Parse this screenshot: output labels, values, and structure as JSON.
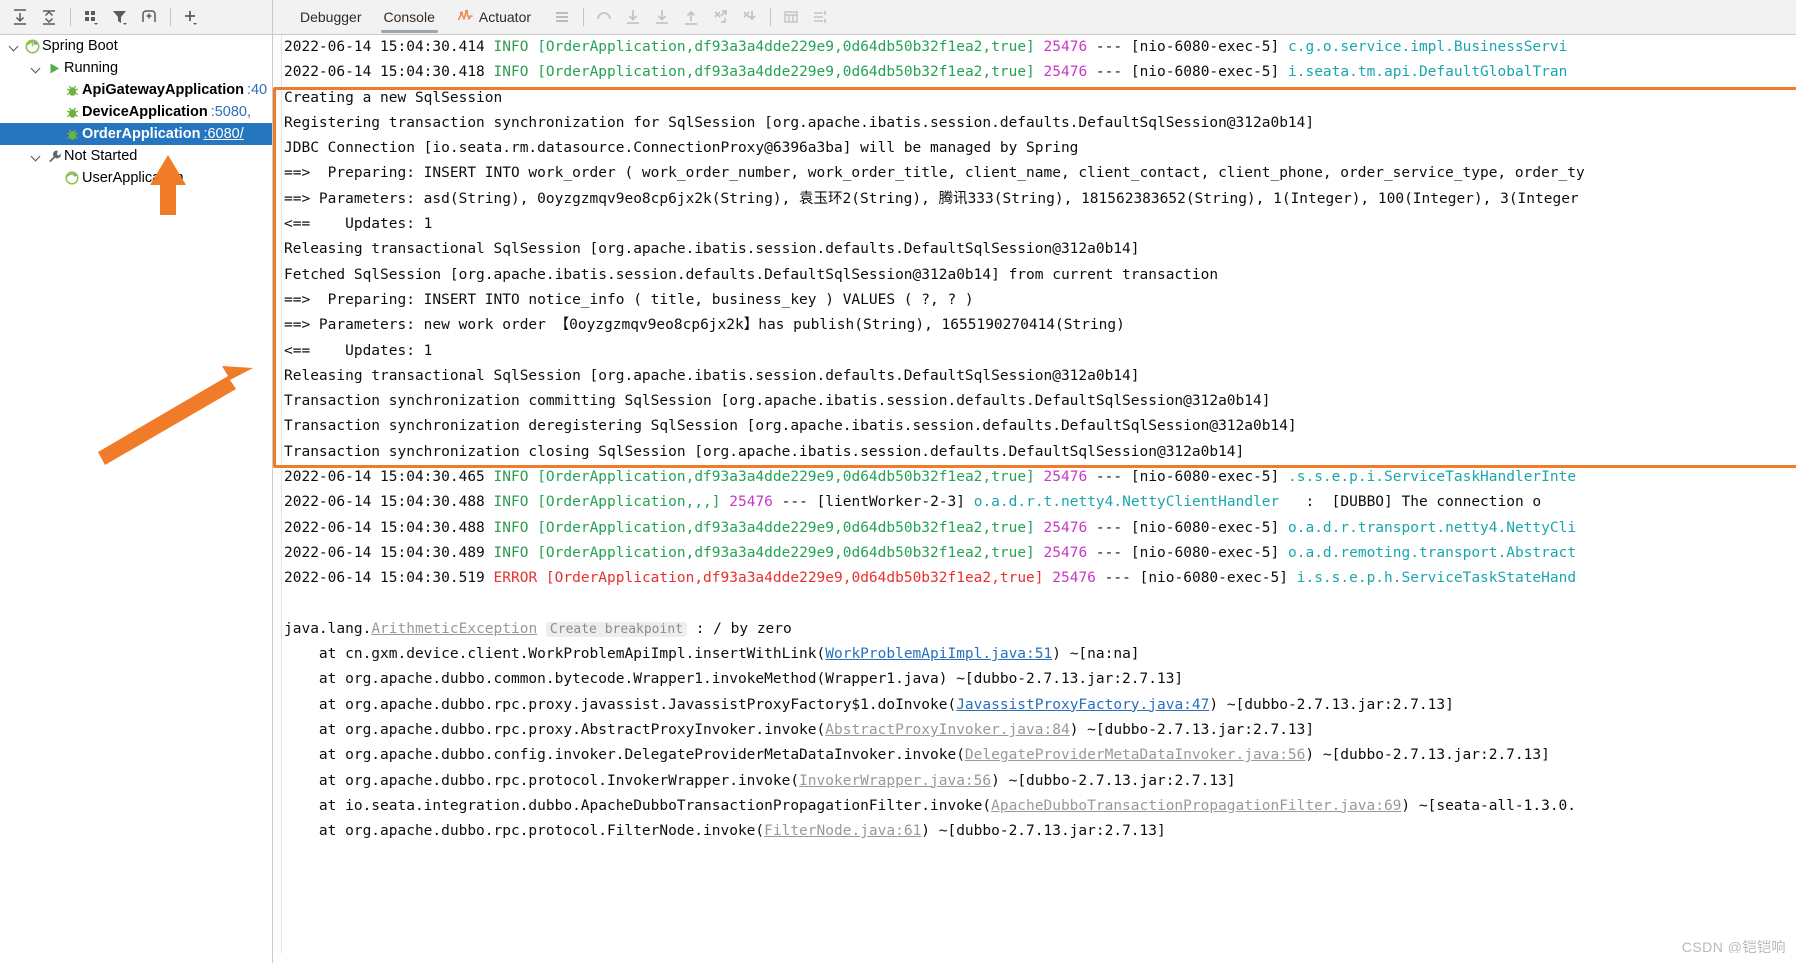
{
  "toolbar": {
    "left_icons": [
      {
        "name": "scroll-to-top-icon",
        "title": "Scroll to Top"
      },
      {
        "name": "collapse-all-icon",
        "title": "Collapse All"
      },
      {
        "name": "group-by-icon",
        "title": "Group"
      },
      {
        "name": "filter-icon",
        "title": "Filter"
      },
      {
        "name": "add-frame-icon",
        "title": "Add Frame"
      },
      {
        "name": "add-icon",
        "title": "Add Configuration"
      }
    ],
    "tabs": [
      {
        "label": "Debugger",
        "active": false
      },
      {
        "label": "Console",
        "active": true
      },
      {
        "label": "Actuator",
        "active": true,
        "icon": "actuator-icon"
      }
    ],
    "right_icons": [
      {
        "name": "menu-lines-icon"
      },
      {
        "name": "step-over-icon"
      },
      {
        "name": "step-into-icon"
      },
      {
        "name": "force-step-into-icon"
      },
      {
        "name": "step-out-icon"
      },
      {
        "name": "drop-frame-icon"
      },
      {
        "name": "run-to-cursor-icon"
      },
      {
        "name": "evaluate-table-icon"
      },
      {
        "name": "settings-lines-icon"
      }
    ]
  },
  "sidebar": {
    "nodes": [
      {
        "indent": 0,
        "arrow": "expanded",
        "icon": "spring-boot-icon",
        "label": "Spring Boot",
        "bold": false,
        "port": "",
        "selected": false
      },
      {
        "indent": 1,
        "arrow": "expanded",
        "icon": "run-icon",
        "label": "Running",
        "bold": false,
        "port": "",
        "selected": false
      },
      {
        "indent": 2,
        "arrow": "none",
        "icon": "debug-bug-icon",
        "label": "ApiGatewayApplication",
        "bold": true,
        "port": ":40",
        "selected": false
      },
      {
        "indent": 2,
        "arrow": "none",
        "icon": "debug-bug-icon",
        "label": "DeviceApplication",
        "bold": true,
        "port": ":5080,",
        "selected": false
      },
      {
        "indent": 2,
        "arrow": "none",
        "icon": "debug-bug-icon",
        "label": "OrderApplication",
        "bold": true,
        "port": ":6080/",
        "selected": true
      },
      {
        "indent": 1,
        "arrow": "expanded",
        "icon": "wrench-icon",
        "label": "Not Started",
        "bold": false,
        "port": "",
        "selected": false
      },
      {
        "indent": 2,
        "arrow": "none",
        "icon": "spring-boot-icon",
        "label": "UserApplication",
        "bold": false,
        "port": "",
        "selected": false
      }
    ]
  },
  "console": {
    "watermark": "CSDN @铠铠响",
    "highlight_color": "#f07c29",
    "lines": [
      {
        "type": "log",
        "ts": "2022-06-14 15:04:30.414",
        "level": "INFO",
        "ctx": "[OrderApplication,df93a3a4dde229e9,0d64db50b32f1ea2,true]",
        "pid": "25476",
        "dash": "---",
        "thread": "[nio-6080-exec-5]",
        "logger": "c.g.o.service.impl.BusinessServi",
        "tail": ""
      },
      {
        "type": "log",
        "ts": "2022-06-14 15:04:30.418",
        "level": "INFO",
        "ctx": "[OrderApplication,df93a3a4dde229e9,0d64db50b32f1ea2,true]",
        "pid": "25476",
        "dash": "---",
        "thread": "[nio-6080-exec-5]",
        "logger": "i.seata.tm.api.DefaultGlobalTran",
        "tail": ""
      },
      {
        "type": "plain",
        "text": "Creating a new SqlSession"
      },
      {
        "type": "plain",
        "text": "Registering transaction synchronization for SqlSession [org.apache.ibatis.session.defaults.DefaultSqlSession@312a0b14]"
      },
      {
        "type": "plain",
        "text": "JDBC Connection [io.seata.rm.datasource.ConnectionProxy@6396a3ba] will be managed by Spring"
      },
      {
        "type": "plain",
        "text": "==>  Preparing: INSERT INTO work_order ( work_order_number, work_order_title, client_name, client_contact, client_phone, order_service_type, order_ty"
      },
      {
        "type": "plain",
        "text": "==> Parameters: asd(String), 0oyzgzmqv9eo8cp6jx2k(String), 袁玉环2(String), 腾讯333(String), 181562383652(String), 1(Integer), 100(Integer), 3(Integer"
      },
      {
        "type": "plain",
        "text": "<==    Updates: 1"
      },
      {
        "type": "plain",
        "text": "Releasing transactional SqlSession [org.apache.ibatis.session.defaults.DefaultSqlSession@312a0b14]"
      },
      {
        "type": "plain",
        "text": "Fetched SqlSession [org.apache.ibatis.session.defaults.DefaultSqlSession@312a0b14] from current transaction"
      },
      {
        "type": "plain",
        "text": "==>  Preparing: INSERT INTO notice_info ( title, business_key ) VALUES ( ?, ? )"
      },
      {
        "type": "plain",
        "text": "==> Parameters: new work order 【0oyzgzmqv9eo8cp6jx2k】has publish(String), 1655190270414(String)"
      },
      {
        "type": "plain",
        "text": "<==    Updates: 1"
      },
      {
        "type": "plain",
        "text": "Releasing transactional SqlSession [org.apache.ibatis.session.defaults.DefaultSqlSession@312a0b14]"
      },
      {
        "type": "plain",
        "text": "Transaction synchronization committing SqlSession [org.apache.ibatis.session.defaults.DefaultSqlSession@312a0b14]"
      },
      {
        "type": "plain",
        "text": "Transaction synchronization deregistering SqlSession [org.apache.ibatis.session.defaults.DefaultSqlSession@312a0b14]"
      },
      {
        "type": "plain",
        "text": "Transaction synchronization closing SqlSession [org.apache.ibatis.session.defaults.DefaultSqlSession@312a0b14]"
      },
      {
        "type": "log",
        "ts": "2022-06-14 15:04:30.465",
        "level": "INFO",
        "ctx": "[OrderApplication,df93a3a4dde229e9,0d64db50b32f1ea2,true]",
        "pid": "25476",
        "dash": "---",
        "thread": "[nio-6080-exec-5]",
        "logger": ".s.s.e.p.i.ServiceTaskHandlerInte",
        "tail": ""
      },
      {
        "type": "log",
        "ts": "2022-06-14 15:04:30.488",
        "level": "INFO",
        "ctx": "[OrderApplication,,,]",
        "pid": "25476",
        "dash": "---",
        "thread": "[lientWorker-2-3]",
        "logger": "o.a.d.r.t.netty4.NettyClientHandler",
        "tail": "   :  [DUBBO] The connection o"
      },
      {
        "type": "log",
        "ts": "2022-06-14 15:04:30.488",
        "level": "INFO",
        "ctx": "[OrderApplication,df93a3a4dde229e9,0d64db50b32f1ea2,true]",
        "pid": "25476",
        "dash": "---",
        "thread": "[nio-6080-exec-5]",
        "logger": "o.a.d.r.transport.netty4.NettyCli",
        "tail": ""
      },
      {
        "type": "log",
        "ts": "2022-06-14 15:04:30.489",
        "level": "INFO",
        "ctx": "[OrderApplication,df93a3a4dde229e9,0d64db50b32f1ea2,true]",
        "pid": "25476",
        "dash": "---",
        "thread": "[nio-6080-exec-5]",
        "logger": "o.a.d.remoting.transport.Abstract",
        "tail": ""
      },
      {
        "type": "log",
        "ts": "2022-06-14 15:04:30.519",
        "level": "ERROR",
        "ctx": "[OrderApplication,df93a3a4dde229e9,0d64db50b32f1ea2,true]",
        "pid": "25476",
        "dash": "---",
        "thread": "[nio-6080-exec-5]",
        "logger": "i.s.s.e.p.h.ServiceTaskStateHand",
        "tail": ""
      },
      {
        "type": "blank",
        "text": ""
      },
      {
        "type": "exception",
        "pre": "java.lang.",
        "link": "ArithmeticException",
        "hint": "Create breakpoint",
        "post": " : / by zero"
      },
      {
        "type": "stack",
        "pre": "    at cn.gxm.device.client.WorkProblemApiImpl.insertWithLink(",
        "link": "WorkProblemApiImpl.java:51",
        "linkStyle": "blue",
        "post": ") ~[na:na]"
      },
      {
        "type": "stack",
        "pre": "    at org.apache.dubbo.common.bytecode.Wrapper1.invokeMethod(Wrapper1.java) ~[dubbo-2.7.13.jar:2.7.13]",
        "link": "",
        "post": ""
      },
      {
        "type": "stack",
        "pre": "    at org.apache.dubbo.rpc.proxy.javassist.JavassistProxyFactory$1.doInvoke(",
        "link": "JavassistProxyFactory.java:47",
        "linkStyle": "blue",
        "post": ") ~[dubbo-2.7.13.jar:2.7.13]"
      },
      {
        "type": "stack",
        "pre": "    at org.apache.dubbo.rpc.proxy.AbstractProxyInvoker.invoke(",
        "link": "AbstractProxyInvoker.java:84",
        "linkStyle": "grey",
        "post": ") ~[dubbo-2.7.13.jar:2.7.13]"
      },
      {
        "type": "stack",
        "pre": "    at org.apache.dubbo.config.invoker.DelegateProviderMetaDataInvoker.invoke(",
        "link": "DelegateProviderMetaDataInvoker.java:56",
        "linkStyle": "grey",
        "post": ") ~[dubbo-2.7.13.jar:2.7.13]"
      },
      {
        "type": "stack",
        "pre": "    at org.apache.dubbo.rpc.protocol.InvokerWrapper.invoke(",
        "link": "InvokerWrapper.java:56",
        "linkStyle": "grey",
        "post": ") ~[dubbo-2.7.13.jar:2.7.13]"
      },
      {
        "type": "stack",
        "pre": "    at io.seata.integration.dubbo.ApacheDubboTransactionPropagationFilter.invoke(",
        "link": "ApacheDubboTransactionPropagationFilter.java:69",
        "linkStyle": "grey",
        "post": ") ~[seata-all-1.3.0."
      },
      {
        "type": "stack",
        "pre": "    at org.apache.dubbo.rpc.protocol.FilterNode.invoke(",
        "link": "FilterNode.java:61",
        "linkStyle": "grey",
        "post": ") ~[dubbo-2.7.13.jar:2.7.13]"
      }
    ]
  }
}
